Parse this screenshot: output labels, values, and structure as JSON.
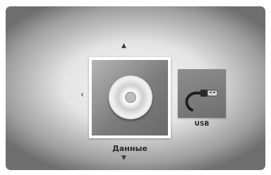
{
  "menu": {
    "items": [
      {
        "label": "Данные",
        "icon": "disc-icon"
      },
      {
        "label": "USB",
        "icon": "usb-cable-icon"
      }
    ]
  },
  "navigation": {
    "up_glyph": "▲",
    "down_glyph": "▼",
    "left_glyph": "‹",
    "right_glyph": "›"
  }
}
